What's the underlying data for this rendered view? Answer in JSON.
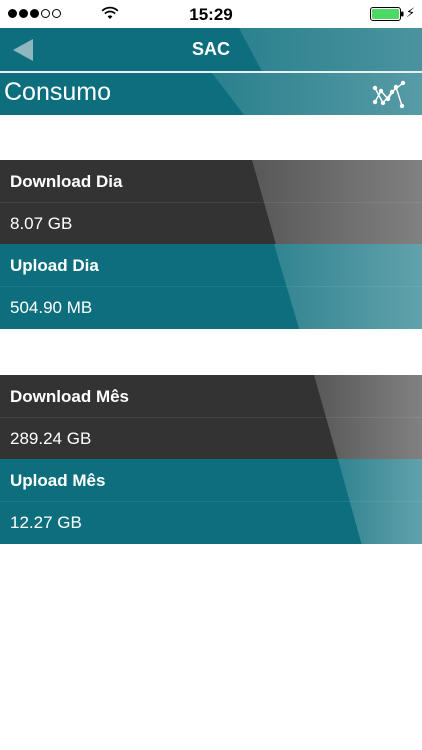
{
  "status_bar": {
    "time": "15:29",
    "signal_bars_filled": 3,
    "signal_bars_total": 5,
    "battery_color": "#4cd964"
  },
  "navbar": {
    "title": "SAC",
    "back_icon": "back-triangle-icon",
    "color": "#0d6f7e"
  },
  "header": {
    "title": "Consumo",
    "chart_icon": "network-chart-icon"
  },
  "daily": {
    "download": {
      "label": "Download Dia",
      "value": "8.07 GB"
    },
    "upload": {
      "label": "Upload Dia",
      "value": "504.90 MB"
    }
  },
  "monthly": {
    "download": {
      "label": "Download Mês",
      "value": "289.24 GB"
    },
    "upload": {
      "label": "Upload Mês",
      "value": "12.27 GB"
    }
  },
  "colors": {
    "teal": "#0d6f7e",
    "dark": "#333333"
  }
}
